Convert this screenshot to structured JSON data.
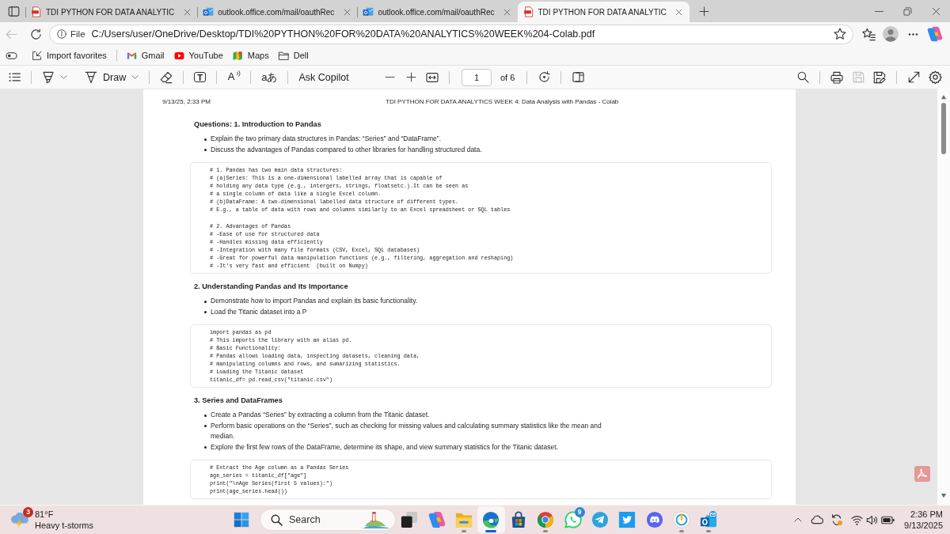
{
  "browser": {
    "tabs": [
      {
        "title": "TDI PYTHON FOR DATA ANALYTIC",
        "kind": "pdf",
        "selected": false
      },
      {
        "title": "outlook.office.com/mail/oauthRec",
        "kind": "mail",
        "selected": false
      },
      {
        "title": "outlook.office.com/mail/oauthRec",
        "kind": "mail",
        "selected": false
      },
      {
        "title": "TDI PYTHON FOR DATA ANALYTIC",
        "kind": "pdf",
        "selected": true
      }
    ],
    "back_button": {
      "disabled": true
    },
    "address_bar": {
      "scheme": "File",
      "url": "C:/Users/user/OneDrive/Desktop/TDI%20PYTHON%20FOR%20DATA%20ANALYTICS%20WEEK%204-Colab.pdf"
    },
    "favorites": [
      {
        "label": "Import favorites",
        "kind": "import"
      },
      {
        "label": "Gmail",
        "kind": "mail"
      },
      {
        "label": "YouTube",
        "kind": "video"
      },
      {
        "label": "Maps",
        "kind": "map"
      },
      {
        "label": "Dell",
        "kind": "folder"
      }
    ]
  },
  "pdf_toolbar": {
    "draw_label": "Draw",
    "text_glyph": "T",
    "read_aloud_glyph": "A",
    "translate_glyph": "aあ",
    "copilot_label": "Ask Copilot",
    "page_field": {
      "value": "1"
    },
    "page_count": "of 6",
    "save_button": {
      "disabled": true
    }
  },
  "document": {
    "header": {
      "date": "9/13/25, 2:33 PM",
      "title": "TDI PYTHON FOR DATA ANALYTICS WEEK 4: Data Analysis with Pandas - Colab"
    },
    "sections": [
      {
        "heading": "Questions: 1. Introduction to Pandas",
        "bullets": [
          "Explain the two primary data structures in Pandas: “Series” and “DataFrame”.",
          "Discuss the advantages of Pandas compared to other libraries for handling structured data."
        ],
        "code": [
          [
            "# 1. Pandas has two main data structures:",
            "# (a)Series: This is a one-dimensional labelled array that is capable of",
            "# holding any data type (e.g., intergers, strings, floatsetc.).It can be seen as",
            "# a single column of data like a single Excel column.",
            "# (b)DataFrame: A two-dimensional labelled data structure of different types.",
            "# E.g., a table of data with rows and columns similarly to an Excel spreadsheet or SQL tables"
          ],
          [
            "# 2. Advantages of Pandas",
            "# -Ease of use for structured data",
            "# -Handles missing data efficiently",
            "# -Integration with many file formats (CSV, Excel, SQL databases)",
            "# -Great for powerful data manipulation functions (e.g., filtering, aggregation and reshaping)",
            "# -It's very fast and efficient  (built on Numpy)"
          ]
        ]
      },
      {
        "heading": "2. Understanding Pandas and Its Importance",
        "bullets": [
          "Demonstrate how to import Pandas and explain its basic functionality.",
          "Load the Titanic dataset into a P"
        ],
        "code": [
          [
            "import pandas as pd",
            "# This imports the library with an alias pd.",
            "# Basic Functionality:",
            "# Pandas allows loading data, inspecting datasets, cleaning data,",
            "# manipulating columns and rows, and sumarizing statistics.",
            "# Loading the Titanic dataset",
            "titanic_df= pd.read_csv(\"titanic.csv\")"
          ]
        ]
      },
      {
        "heading": "3. Series and DataFrames",
        "bullets": [
          "Create a Pandas “Series” by extracting a column from the Titanic dataset.",
          "Perform basic operations on the “Series”, such as checking for missing values and calculating summary statistics like the mean and median.",
          "Explore the first few rows of the DataFrame, determine its shape, and view summary statistics for the Titanic dataset."
        ],
        "code": [
          [
            "# Extract the Age column as a Pandas Series",
            "age_series = titanic_df[\"age\"]",
            "print(\"\\nAge Series(first 5 values):\")",
            "print(age_series.head())"
          ]
        ]
      }
    ]
  },
  "taskbar": {
    "weather": {
      "badge": "3",
      "temperature": "81°F",
      "condition": "Heavy t-storms"
    },
    "search": {
      "placeholder": "Search"
    },
    "apps": [
      {
        "kind": "taskview",
        "running": false,
        "selected": false
      },
      {
        "kind": "copilot",
        "running": false,
        "selected": false
      },
      {
        "kind": "folder",
        "running": true,
        "selected": false
      },
      {
        "kind": "edge",
        "running": true,
        "selected": true
      },
      {
        "kind": "store",
        "running": false,
        "selected": false
      },
      {
        "kind": "chrome",
        "running": true,
        "selected": false
      },
      {
        "kind": "whatsapp",
        "running": false,
        "selected": false,
        "badge": "9"
      },
      {
        "kind": "telegram",
        "running": false,
        "selected": false
      },
      {
        "kind": "twitter",
        "running": false,
        "selected": false
      },
      {
        "kind": "discord",
        "running": false,
        "selected": false
      },
      {
        "kind": "power",
        "running": true,
        "selected": false
      },
      {
        "kind": "outlook",
        "running": true,
        "selected": false
      }
    ],
    "clock": {
      "time": "2:36 PM",
      "date": "9/13/2025"
    }
  }
}
